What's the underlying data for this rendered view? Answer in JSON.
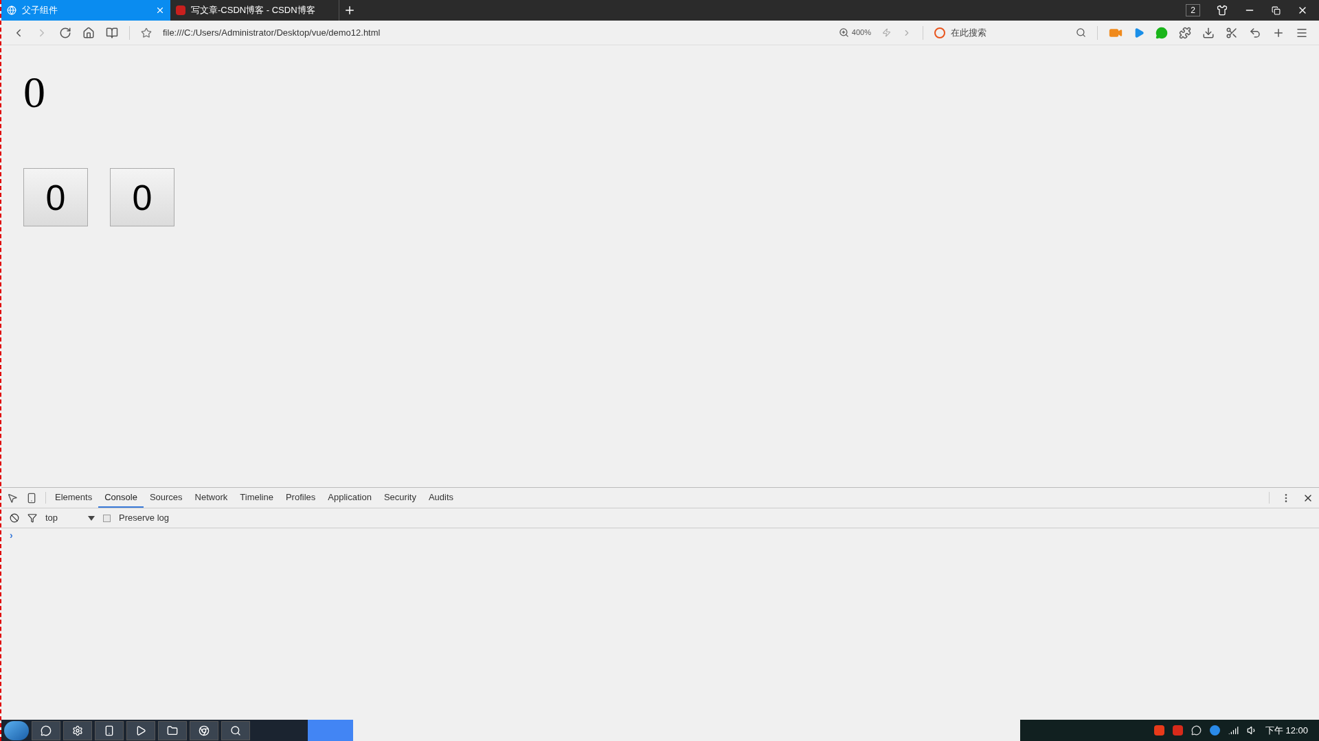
{
  "browser": {
    "tabs": [
      {
        "title": "父子组件",
        "selected": true,
        "kind": "globe"
      },
      {
        "title": "写文章-CSDN博客 - CSDN博客",
        "selected": false,
        "kind": "csdn"
      }
    ],
    "window_count": "2",
    "url": "file:///C:/Users/Administrator/Desktop/vue/demo12.html",
    "zoom": "400%",
    "search_placeholder": "在此搜索"
  },
  "page": {
    "total": "0",
    "counters": [
      "0",
      "0"
    ]
  },
  "devtools": {
    "tabs": [
      {
        "label": "Elements",
        "selected": false
      },
      {
        "label": "Console",
        "selected": true
      },
      {
        "label": "Sources",
        "selected": false
      },
      {
        "label": "Network",
        "selected": false
      },
      {
        "label": "Timeline",
        "selected": false
      },
      {
        "label": "Profiles",
        "selected": false
      },
      {
        "label": "Application",
        "selected": false
      },
      {
        "label": "Security",
        "selected": false
      },
      {
        "label": "Audits",
        "selected": false
      }
    ],
    "context": "top",
    "preserve_log": {
      "label": "Preserve log",
      "checked": false
    },
    "prompt": "›"
  },
  "taskbar": {
    "clock": "下午 12:00"
  }
}
